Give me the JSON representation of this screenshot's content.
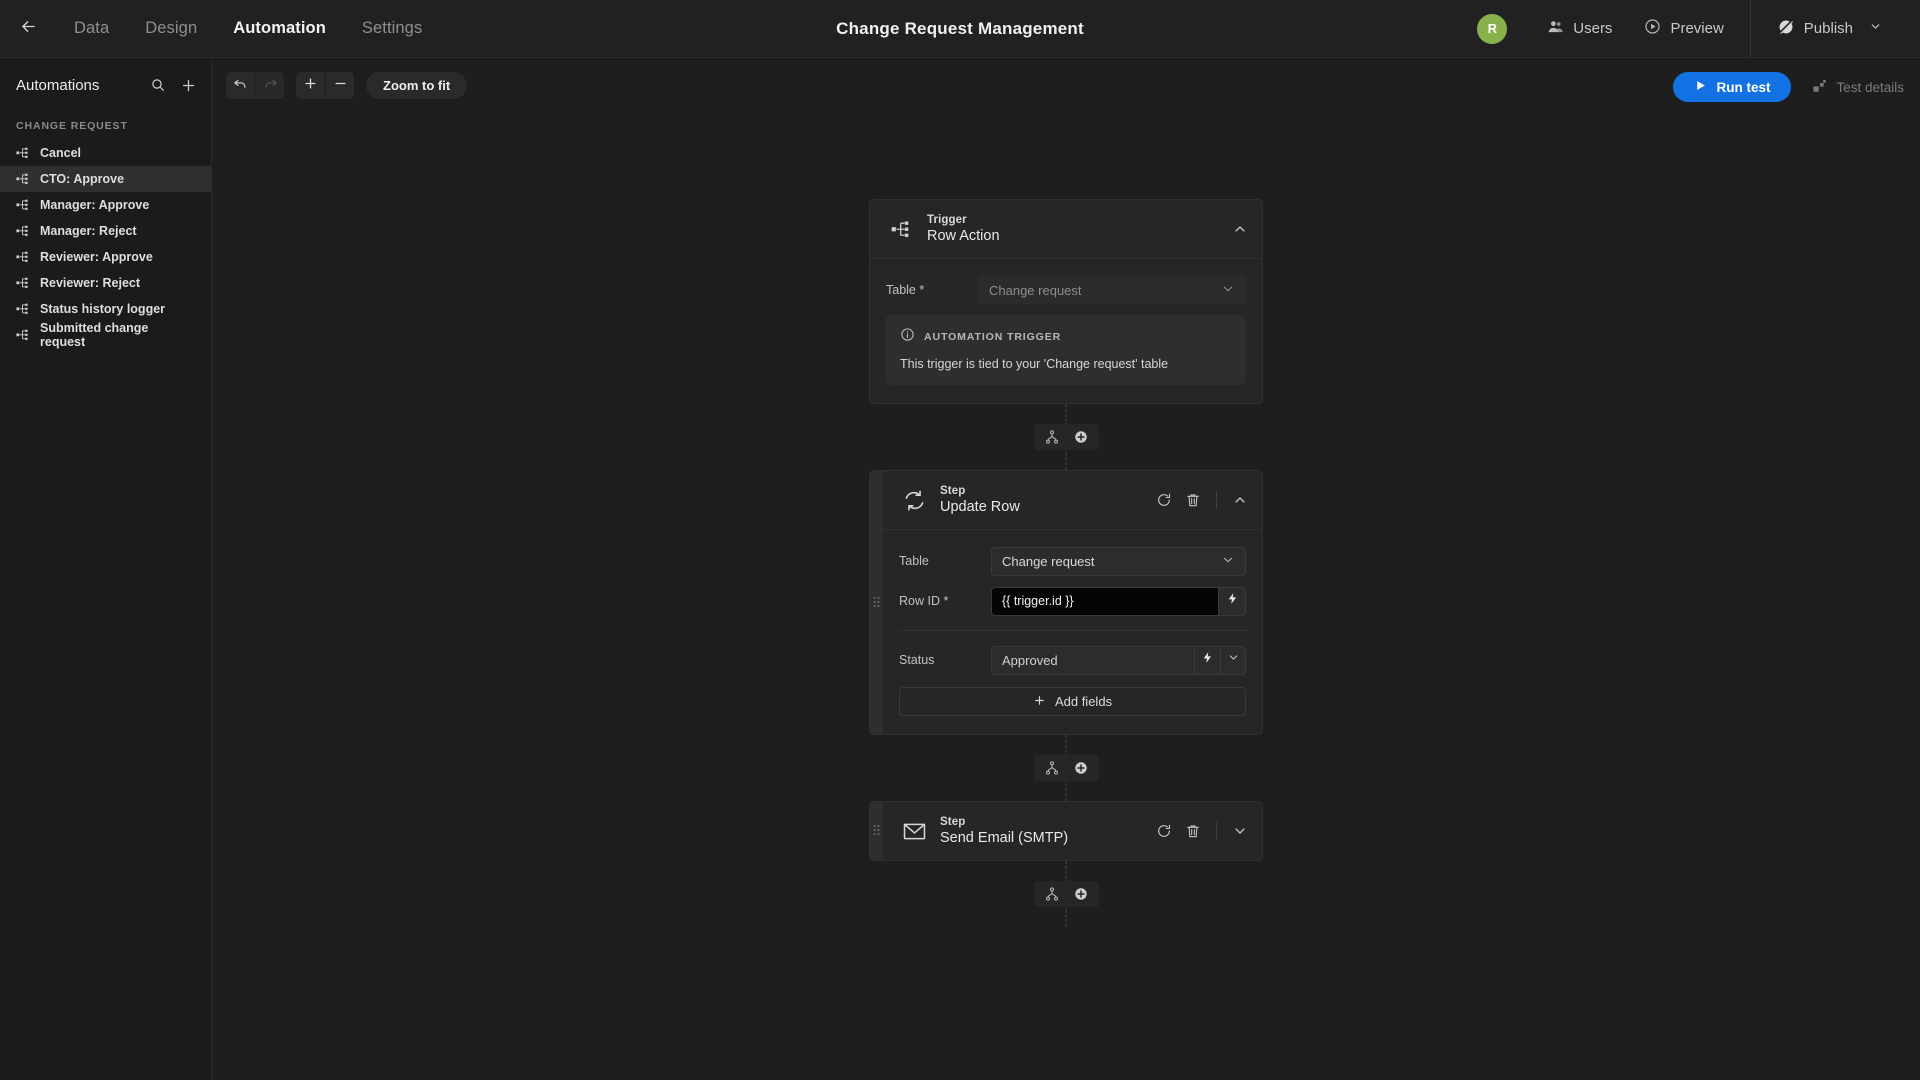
{
  "topbar": {
    "back_icon": "arrow-left-icon",
    "tabs": [
      {
        "label": "Data",
        "active": false
      },
      {
        "label": "Design",
        "active": false
      },
      {
        "label": "Automation",
        "active": true
      },
      {
        "label": "Settings",
        "active": false
      }
    ],
    "title": "Change Request Management",
    "avatar_initial": "R",
    "avatar_color": "#88b04b",
    "users_label": "Users",
    "preview_label": "Preview",
    "publish_label": "Publish"
  },
  "sidebar": {
    "title": "Automations",
    "search_icon": "search-icon",
    "add_icon": "plus-icon",
    "group_label": "CHANGE REQUEST",
    "items": [
      {
        "label": "Cancel",
        "selected": false
      },
      {
        "label": "CTO: Approve",
        "selected": true
      },
      {
        "label": "Manager: Approve",
        "selected": false
      },
      {
        "label": "Manager: Reject",
        "selected": false
      },
      {
        "label": "Reviewer: Approve",
        "selected": false
      },
      {
        "label": "Reviewer: Reject",
        "selected": false
      },
      {
        "label": "Status history logger",
        "selected": false
      },
      {
        "label": "Submitted change request",
        "selected": false
      }
    ]
  },
  "toolbar": {
    "undo_icon": "undo-icon",
    "redo_icon": "redo-icon",
    "zoom_in_icon": "plus-icon",
    "zoom_out_icon": "minus-icon",
    "zoom_to_fit_label": "Zoom to fit",
    "run_test_label": "Run test",
    "run_test_color": "#1271e3",
    "test_details_label": "Test details"
  },
  "flow": {
    "trigger": {
      "kind": "Trigger",
      "name": "Row Action",
      "icon": "flow-node-icon",
      "collapse_icon": "chevron-up-icon",
      "table_label": "Table *",
      "table_value": "Change request",
      "info_label": "AUTOMATION TRIGGER",
      "info_icon": "info-icon",
      "info_text": "This trigger is tied to your 'Change request' table"
    },
    "connector1": {
      "branch_icon": "branch-icon",
      "add_icon": "plus-circle-icon"
    },
    "step_update_row": {
      "kind": "Step",
      "name": "Update Row",
      "icon": "refresh-sync-icon",
      "rerun_icon": "rerun-icon",
      "delete_icon": "trash-icon",
      "collapse_icon": "chevron-up-icon",
      "drag_icon": "drag-handle-icon",
      "table_label": "Table",
      "table_value": "Change request",
      "row_id_label": "Row ID *",
      "row_id_value": "{{ trigger.id }}",
      "row_id_bind_icon": "lightning-icon",
      "status_label": "Status",
      "status_value": "Approved",
      "status_bind_icon": "lightning-icon",
      "status_chev_icon": "chevron-down-icon",
      "add_fields_label": "Add fields",
      "add_fields_icon": "plus-icon"
    },
    "connector2": {
      "branch_icon": "branch-icon",
      "add_icon": "plus-circle-icon"
    },
    "step_send_email": {
      "kind": "Step",
      "name": "Send Email (SMTP)",
      "icon": "envelope-icon",
      "rerun_icon": "rerun-icon",
      "delete_icon": "trash-icon",
      "expand_icon": "chevron-down-icon",
      "drag_icon": "drag-handle-icon"
    },
    "connector3": {
      "branch_icon": "branch-icon",
      "add_icon": "plus-circle-icon"
    }
  }
}
